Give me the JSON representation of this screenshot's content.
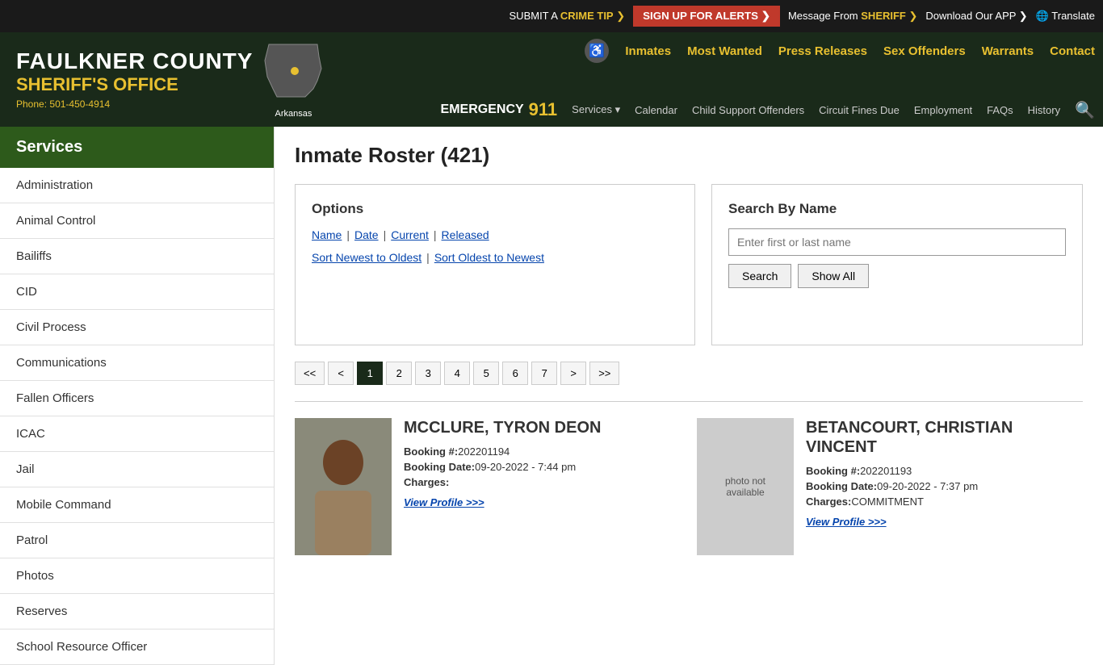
{
  "topbar": {
    "crime_tip": "SUBMIT A",
    "crime_tip_link": "CRIME TIP",
    "crime_tip_arrow": "❯",
    "alerts_btn": "SIGN UP FOR ALERTS ❯",
    "sheriff_msg_pre": "Message From",
    "sheriff_msg_name": "SHERIFF",
    "sheriff_msg_arrow": "❯",
    "download": "Download Our APP ❯",
    "translate": "Translate"
  },
  "header": {
    "county": "FAULKNER COUNTY",
    "office": "SHERIFF'S OFFICE",
    "phone_label": "Phone:",
    "phone": "501-450-4914",
    "arkansas": "Arkansas",
    "nav_top": [
      "Inmates",
      "Most Wanted",
      "Press Releases",
      "Sex Offenders",
      "Warrants",
      "Contact"
    ],
    "emergency": "EMERGENCY",
    "emergency_num": "911",
    "nav_bottom": [
      "Services ▾",
      "Calendar",
      "Child Support Offenders",
      "Circuit Fines Due",
      "Employment",
      "FAQs",
      "History"
    ]
  },
  "sidebar": {
    "title": "Services",
    "items": [
      "Administration",
      "Animal Control",
      "Bailiffs",
      "CID",
      "Civil Process",
      "Communications",
      "Fallen Officers",
      "ICAC",
      "Jail",
      "Mobile Command",
      "Patrol",
      "Photos",
      "Reserves",
      "School Resource Officer"
    ]
  },
  "main": {
    "page_title": "Inmate Roster (421)",
    "options": {
      "heading": "Options",
      "filter_links": [
        "Name",
        "Date",
        "Current",
        "Released"
      ],
      "sort_links": [
        "Sort Newest to Oldest",
        "Sort Oldest to Newest"
      ]
    },
    "search": {
      "heading": "Search By Name",
      "placeholder": "Enter first or last name",
      "search_btn": "Search",
      "showall_btn": "Show All"
    },
    "pagination": {
      "first": "<<",
      "prev": "<",
      "pages": [
        "1",
        "2",
        "3",
        "4",
        "5",
        "6",
        "7"
      ],
      "next": ">",
      "last": ">>",
      "active": "1"
    },
    "inmates": [
      {
        "name": "MCCLURE, TYRON DEON",
        "booking_num": "202201194",
        "booking_date": "09-20-2022 - 7:44 pm",
        "charges": "",
        "view_profile": "View Profile >>>",
        "has_photo": true,
        "photo_color": "#6b6b5a"
      },
      {
        "name": "BETANCOURT, CHRISTIAN VINCENT",
        "booking_num": "202201193",
        "booking_date": "09-20-2022 - 7:37 pm",
        "charges": "COMMITMENT",
        "view_profile": "View Profile >>>",
        "has_photo": false,
        "photo_placeholder": "photo not available"
      }
    ]
  }
}
